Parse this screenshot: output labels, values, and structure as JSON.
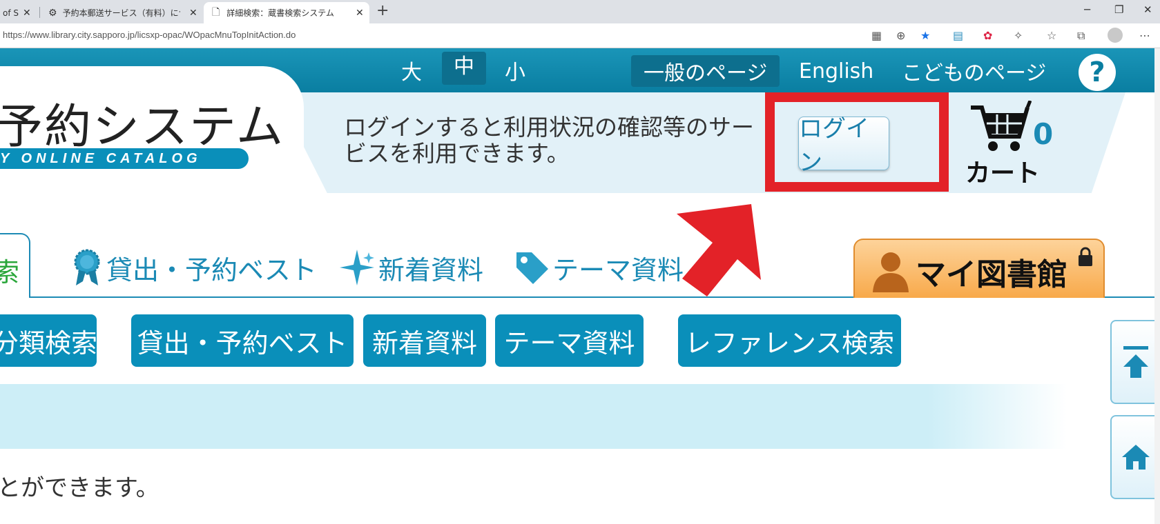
{
  "browser": {
    "tabs": [
      {
        "label": "of S",
        "active": false
      },
      {
        "label": "予約本郵送サービス（有料）につい",
        "active": false
      },
      {
        "label": "詳細検索：蔵書検索システム",
        "active": true
      }
    ],
    "url": "https://www.library.city.sapporo.jp/licsxp-opac/WOpacMnuTopInitAction.do"
  },
  "header": {
    "font_sizes": [
      "大",
      "中",
      "小"
    ],
    "active_font_size": "中",
    "links": [
      {
        "label": "一般のページ",
        "active": true
      },
      {
        "label": "English",
        "active": false
      },
      {
        "label": "こどものページ",
        "active": false
      }
    ],
    "help": "?"
  },
  "logo": {
    "title": "予約システム",
    "subtitle": "Y ONLINE CATALOG"
  },
  "login": {
    "message": "ログインすると利用状況の確認等のサービスを利用できます。",
    "button_label": "ログイン"
  },
  "cart": {
    "count": "0",
    "label": "カート"
  },
  "nav_tabs": {
    "first_partial": "索",
    "items": [
      {
        "label": "貸出・予約ベスト",
        "icon": "award-ribbon-icon"
      },
      {
        "label": "新着資料",
        "icon": "sparkle-icon"
      },
      {
        "label": "テーマ資料",
        "icon": "tag-icon"
      }
    ],
    "mylibrary": "マイ図書館"
  },
  "quick_buttons": [
    "分類検索",
    "貸出・予約ベスト",
    "新着資料",
    "テーマ資料",
    "レファレンス検索"
  ],
  "body_text": "とができます。",
  "colors": {
    "header_blue": "#0a7ea1",
    "button_blue": "#0a8fba",
    "highlight_red": "#e32228",
    "mylibrary_orange": "#f8a94a"
  }
}
